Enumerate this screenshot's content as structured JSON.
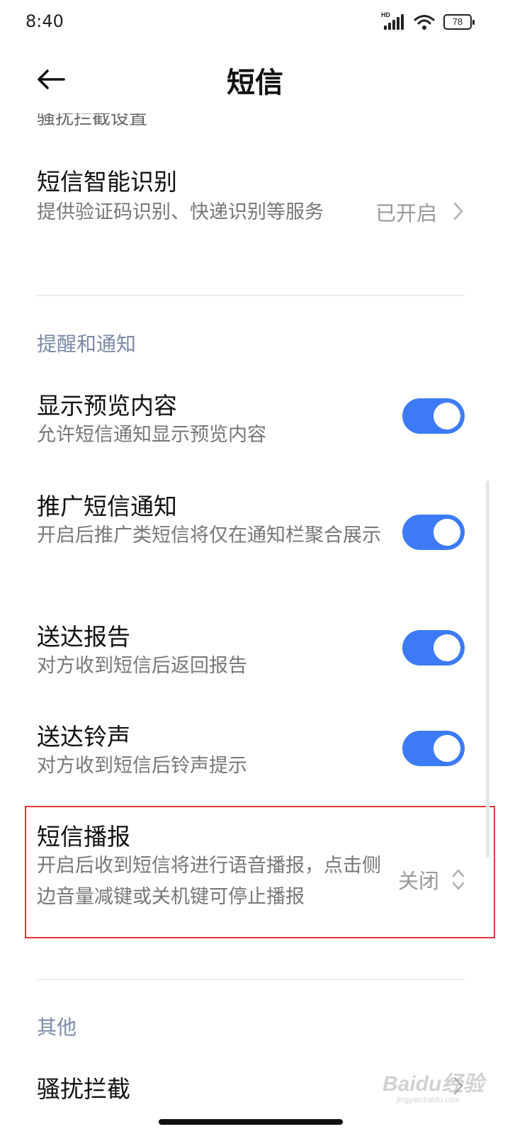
{
  "status_bar": {
    "time": "8:40",
    "network_badge": "HD",
    "battery": "78"
  },
  "header": {
    "title": "短信",
    "back_icon": "arrow-left-icon"
  },
  "peek_text": "骚扰拦截设置",
  "sms_smart": {
    "title": "短信智能识别",
    "subtitle": "提供验证码识别、快递识别等服务",
    "value": "已开启"
  },
  "section_notify": {
    "label": "提醒和通知"
  },
  "toggles": [
    {
      "title": "显示预览内容",
      "subtitle": "允许短信通知显示预览内容",
      "on": true
    },
    {
      "title": "推广短信通知",
      "subtitle": "开启后推广类短信将仅在通知栏聚合展示",
      "on": true
    },
    {
      "title": "送达报告",
      "subtitle": "对方收到短信后返回报告",
      "on": true
    },
    {
      "title": "送达铃声",
      "subtitle": "对方收到短信后铃声提示",
      "on": true
    }
  ],
  "sms_broadcast": {
    "title": "短信播报",
    "subtitle": "开启后收到短信将进行语音播报，点击侧边音量减键或关机键可停止播报",
    "value": "关闭"
  },
  "section_other": {
    "label": "其他"
  },
  "harass": {
    "title": "骚扰拦截"
  },
  "watermark": {
    "text": "Baidu经验",
    "sub": "jingyan.baidu.com"
  },
  "colors": {
    "accent": "#3d7bf6",
    "highlight": "#e53935",
    "section": "#7a8aa6"
  }
}
